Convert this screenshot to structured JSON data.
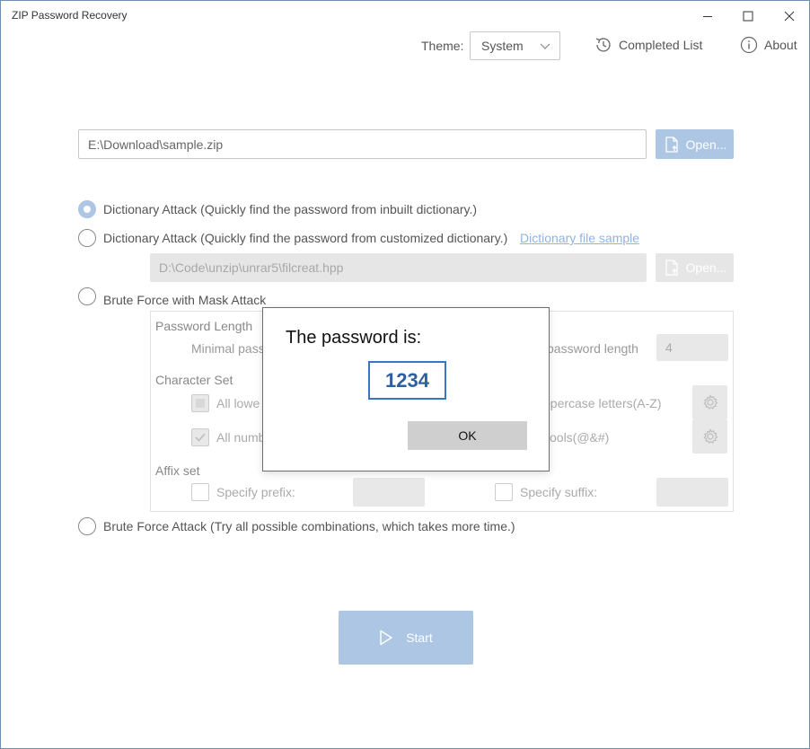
{
  "window": {
    "title": "ZIP Password Recovery"
  },
  "topbar": {
    "theme_label": "Theme:",
    "theme_value": "System",
    "completed_list": "Completed List",
    "about": "About"
  },
  "file": {
    "path": "E:\\Download\\sample.zip",
    "open_label": "Open..."
  },
  "options": {
    "dict_inbuilt": "Dictionary Attack (Quickly find the password from inbuilt dictionary.)",
    "dict_custom": "Dictionary Attack (Quickly find the password from customized dictionary.)",
    "dict_sample_link": "Dictionary file sample",
    "dict_path": "D:\\Code\\unzip\\unrar5\\filcreat.hpp",
    "dict_open_label": "Open...",
    "mask": "Brute Force with Mask Attack",
    "brute": "Brute Force Attack (Try all possible combinations, which takes more time.)"
  },
  "mask": {
    "password_length": "Password Length",
    "minimal_length": "Minimal pass",
    "maximal_length": "password length",
    "maximal_value": "4",
    "character_set": "Character Set",
    "lowercase": "All lowe",
    "uppercase": "ppercase letters(A-Z)",
    "numbers": "All numb",
    "symbols": "ools(@&#)",
    "affix_set": "Affix set",
    "prefix": "Specify prefix:",
    "suffix": "Specify suffix:"
  },
  "start": {
    "label": "Start"
  },
  "dialog": {
    "message": "The password is:",
    "password": "1234",
    "ok": "OK"
  },
  "state": {
    "selected_option": "dict_inbuilt",
    "numbers_checked": true
  },
  "colors": {
    "accent": "#adc6e3",
    "link": "#8fb4df",
    "password_border": "#3a75c4",
    "password_text": "#2f5f9e"
  }
}
